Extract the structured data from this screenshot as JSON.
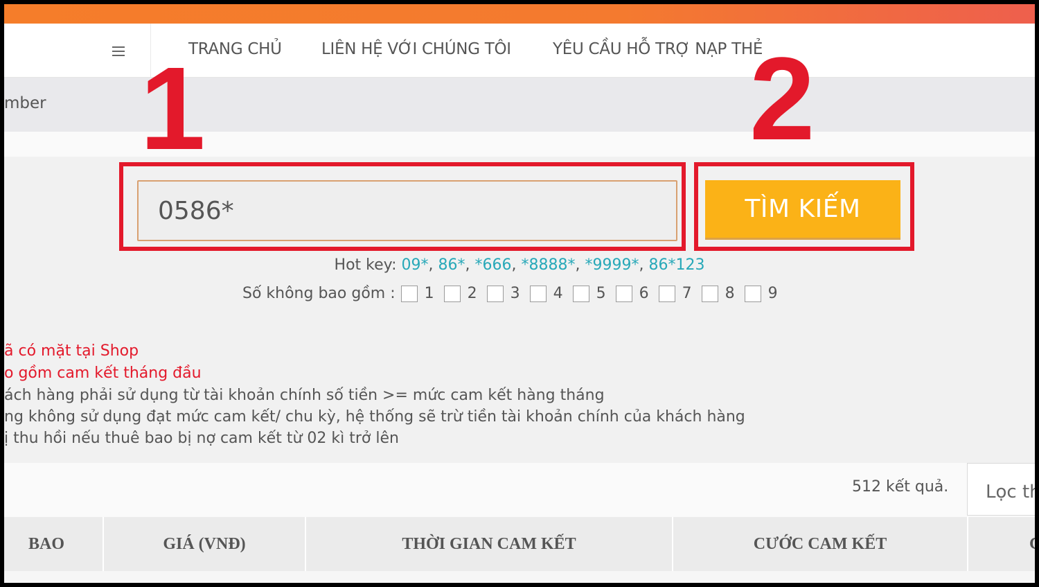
{
  "nav": {
    "links": [
      "TRANG CHỦ",
      "LIÊN HỆ VỚI CHÚNG TÔI",
      "YÊU CẦU HỖ TRỢ NẠP THẺ"
    ]
  },
  "breadcrumb": "mber",
  "search": {
    "value": "0586*",
    "button_label": "TÌM KIẾM"
  },
  "annotations": {
    "step1": "1",
    "step2": "2"
  },
  "hotkey": {
    "label": "Hot key: ",
    "keys": [
      "09*",
      "86*",
      "*666",
      "*8888*",
      "*9999*",
      "86*123"
    ]
  },
  "exclude": {
    "label": "Số không bao gồm :",
    "digits": [
      "1",
      "2",
      "3",
      "4",
      "5",
      "6",
      "7",
      "8",
      "9"
    ]
  },
  "notes": [
    "ã có mặt tại Shop",
    "o gồm cam kết tháng đầu",
    "ách hàng phải sử dụng từ tài khoản chính số tiền >= mức cam kết hàng tháng",
    "ng không sử dụng đạt mức cam kết/ chu kỳ, hệ thống sẽ trừ tiền tài khoản chính của khách hàng",
    "ị thu hồi nếu thuê bao bị nợ cam kết từ 02 kì trở lên"
  ],
  "results": {
    "count": "512 kết quả.",
    "filter_label": "Lọc th"
  },
  "table": {
    "headers": [
      "BAO",
      "GIÁ (VNĐ)",
      "THỜI GIAN CAM KẾT",
      "CƯỚC CAM KẾT",
      "C"
    ]
  },
  "colors": {
    "accent_orange": "#f57d2a",
    "button_yellow": "#fbb217",
    "annotation_red": "#e3192b",
    "hotkey_teal": "#27a8b8"
  }
}
